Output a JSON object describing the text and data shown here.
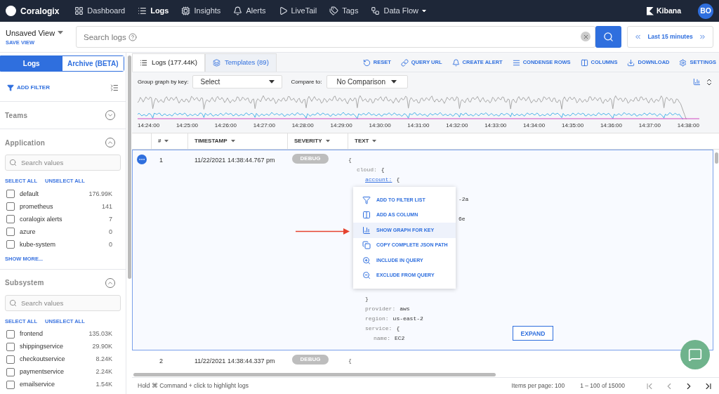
{
  "nav": {
    "brand": "Coralogix",
    "items": [
      {
        "label": "Dashboard",
        "selected": false
      },
      {
        "label": "Logs",
        "selected": true
      },
      {
        "label": "Insights",
        "selected": false
      },
      {
        "label": "Alerts",
        "selected": false
      },
      {
        "label": "LiveTail",
        "selected": false
      },
      {
        "label": "Tags",
        "selected": false
      },
      {
        "label": "Data Flow",
        "selected": false
      }
    ],
    "kibana": "Kibana",
    "avatar": "BO"
  },
  "view": {
    "name": "Unsaved View",
    "save": "SAVE VIEW"
  },
  "search": {
    "placeholder": "Search logs",
    "time": "Last 15 minutes"
  },
  "sidebar": {
    "tabs": [
      {
        "label": "Logs",
        "selected": true
      },
      {
        "label": "Archive (BETA)",
        "selected": false
      }
    ],
    "add_filter": "ADD FILTER",
    "sections": [
      {
        "title": "Teams",
        "expanded": false
      },
      {
        "title": "Application",
        "expanded": true,
        "placeholder": "Search values",
        "select_all": "SELECT ALL",
        "unselect_all": "UNSELECT ALL",
        "more": "SHOW MORE...",
        "values": [
          {
            "name": "default",
            "count": "176.99K",
            "checked": false
          },
          {
            "name": "prometheus",
            "count": "141",
            "checked": false
          },
          {
            "name": "coralogix alerts",
            "count": "7",
            "checked": false
          },
          {
            "name": "azure",
            "count": "0",
            "checked": false
          },
          {
            "name": "kube-system",
            "count": "0",
            "checked": false
          }
        ]
      },
      {
        "title": "Subsystem",
        "expanded": true,
        "placeholder": "Search values",
        "select_all": "SELECT ALL",
        "unselect_all": "UNSELECT ALL",
        "values": [
          {
            "name": "frontend",
            "count": "135.03K",
            "checked": false
          },
          {
            "name": "shippingservice",
            "count": "29.90K",
            "checked": false
          },
          {
            "name": "checkoutservice",
            "count": "8.24K",
            "checked": false
          },
          {
            "name": "paymentservice",
            "count": "2.24K",
            "checked": false
          },
          {
            "name": "emailservice",
            "count": "1.54K",
            "checked": false
          }
        ]
      }
    ]
  },
  "tabs": [
    {
      "label": "Logs (177.44K)",
      "selected": true
    },
    {
      "label": "Templates (89)",
      "selected": false
    }
  ],
  "actions": [
    "RESET",
    "QUERY URL",
    "CREATE ALERT",
    "CONDENSE ROWS",
    "COLUMNS",
    "DOWNLOAD",
    "SETTINGS"
  ],
  "graph_controls": {
    "group_label": "Group graph by key:",
    "group_value": "Select",
    "compare_label": "Compare to:",
    "compare_value": "No Comparison"
  },
  "graph": {
    "times": [
      "14:24:00",
      "14:25:00",
      "14:26:00",
      "14:27:00",
      "14:28:00",
      "14:29:00",
      "14:30:00",
      "14:31:00",
      "14:32:00",
      "14:33:00",
      "14:34:00",
      "14:35:00",
      "14:36:00",
      "14:37:00",
      "14:38:00"
    ]
  },
  "table": {
    "columns": [
      "#",
      "TIMESTAMP",
      "SEVERITY",
      "TEXT"
    ],
    "rows": [
      {
        "n": "1",
        "timestamp": "11/22/2021 14:38:44.767 pm",
        "severity": "DEBUG",
        "selected": true,
        "lines": [
          {
            "text": "{",
            "children": [
              {
                "key": "cloud:",
                "text": "{",
                "children": [
                  {
                    "key": "account:",
                    "text": "{",
                    "link": true
                  },
                  {
                    "kind": "fragment",
                    "text": "-2a"
                  },
                  {
                    "kind": "fragment",
                    "text": "6e"
                  },
                  {
                    "kind": "close",
                    "text": "}"
                  },
                  {
                    "key": "provider:",
                    "text": "aws"
                  },
                  {
                    "key": "region:",
                    "text": "us-east-2"
                  },
                  {
                    "key": "service:",
                    "text": "{",
                    "children": [
                      {
                        "key": "name:",
                        "text": "EC2"
                      }
                    ]
                  }
                ]
              }
            ]
          }
        ],
        "expand": "EXPAND"
      },
      {
        "n": "2",
        "timestamp": "11/22/2021 14:38:44.337 pm",
        "severity": "DEBUG",
        "selected": false,
        "lines": [
          {
            "text": "{"
          }
        ]
      }
    ]
  },
  "menu": [
    {
      "label": "ADD TO FILTER LIST",
      "selected": false
    },
    {
      "label": "ADD AS COLUMN",
      "selected": false
    },
    {
      "label": "SHOW GRAPH FOR KEY",
      "selected": true
    },
    {
      "label": "COPY COMPLETE JSON PATH",
      "selected": false
    },
    {
      "label": "INCLUDE IN QUERY",
      "selected": false
    },
    {
      "label": "EXCLUDE FROM QUERY",
      "selected": false
    }
  ],
  "footer": {
    "hint": "Hold ⌘ Command + click to highlight logs",
    "per_page": "Items per page: 100",
    "range": "1 – 100 of 15000"
  }
}
